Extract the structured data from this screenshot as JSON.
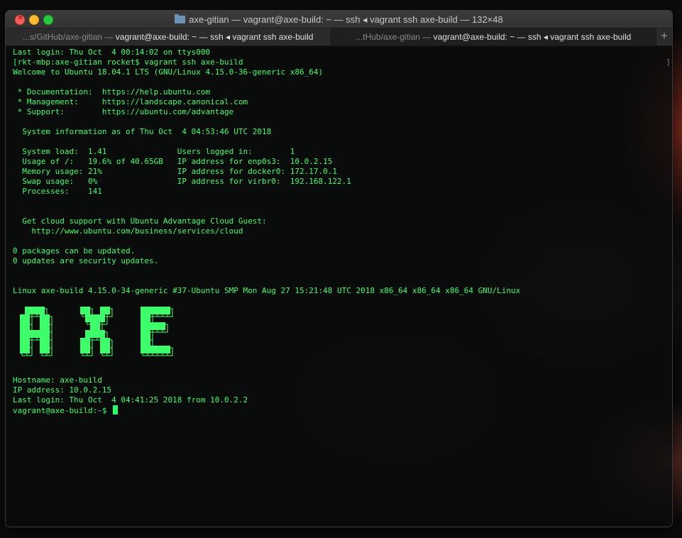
{
  "window": {
    "title": "axe-gitian — vagrant@axe-build: ~ — ssh ◂ vagrant ssh axe-build — 132×48"
  },
  "tabs": [
    {
      "dim": "...s/GitHub/axe-gitian — ",
      "bright": "vagrant@axe-build: ~ — ssh ◂ vagrant ssh axe-build",
      "active": false
    },
    {
      "dim": "...tHub/axe-gitian — ",
      "bright": "vagrant@axe-build: ~ — ssh ◂ vagrant ssh axe-build",
      "active": true
    }
  ],
  "tab_add_label": "+",
  "terminal": {
    "lines": [
      "Last login: Thu Oct  4 00:14:02 on ttys000",
      "[rkt-mbp:axe-gitian rocket$ vagrant ssh axe-build",
      "Welcome to Ubuntu 18.04.1 LTS (GNU/Linux 4.15.0-36-generic x86_64)",
      "",
      " * Documentation:  https://help.ubuntu.com",
      " * Management:     https://landscape.canonical.com",
      " * Support:        https://ubuntu.com/advantage",
      "",
      "  System information as of Thu Oct  4 04:53:46 UTC 2018",
      "",
      "  System load:  1.41               Users logged in:        1",
      "  Usage of /:   19.6% of 40.65GB   IP address for enp0s3:  10.0.2.15",
      "  Memory usage: 21%                IP address for docker0: 172.17.0.1",
      "  Swap usage:   0%                 IP address for virbr0:  192.168.122.1",
      "  Processes:    141",
      "",
      "",
      "  Get cloud support with Ubuntu Advantage Cloud Guest:",
      "    http://www.ubuntu.com/business/services/cloud",
      "",
      "0 packages can be updated.",
      "0 updates are security updates.",
      "",
      "",
      "Linux axe-build 4.15.0-34-generic #37-Ubuntu SMP Mon Aug 27 15:21:48 UTC 2018 x86_64 x86_64 x86_64 GNU/Linux"
    ],
    "scroll_marker": "]",
    "ascii_banner": "AXE",
    "after_banner": [
      "Hostname: axe-build",
      "IP address: 10.0.2.15",
      "Last login: Thu Oct  4 04:41:25 2018 from 10.0.2.2"
    ],
    "prompt_user": "vagrant@axe-build:",
    "prompt_path": "~",
    "prompt_symbol": "$ "
  },
  "colors": {
    "terminal_text": "#3cff6a",
    "prompt_path": "#6b8cff",
    "cursor": "#25ff66"
  }
}
